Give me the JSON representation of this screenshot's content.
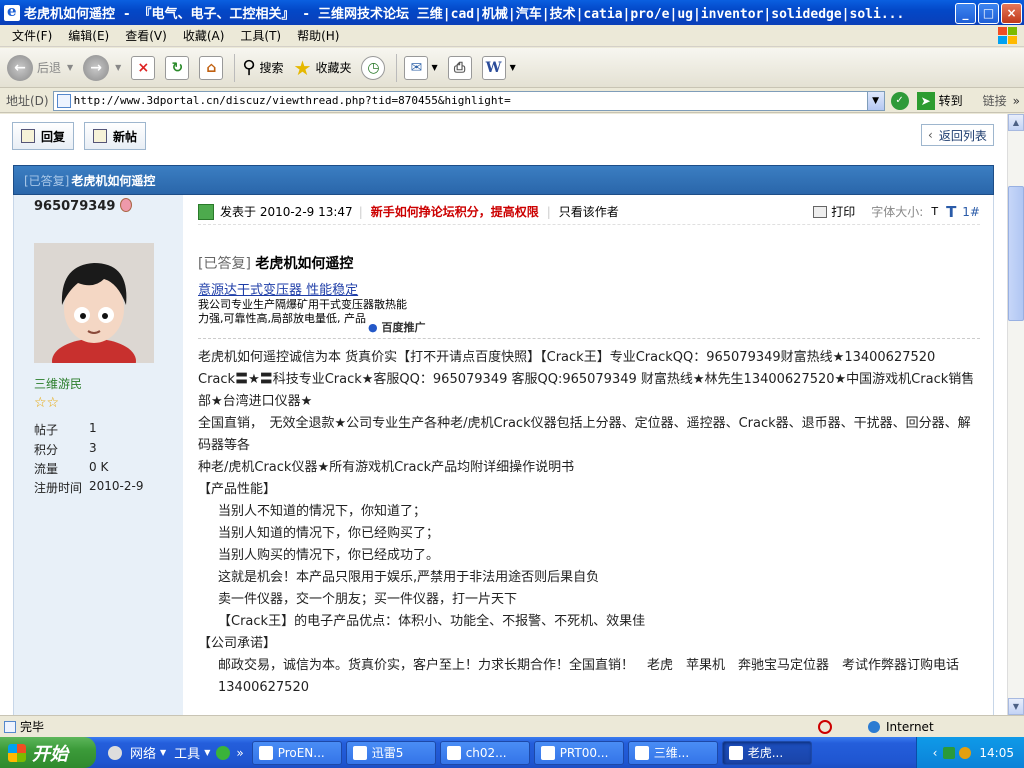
{
  "window": {
    "title": "老虎机如何遥控 - 『电气、电子、工控相关』 - 三维网技术论坛 三维|cad|机械|汽车|技术|catia|pro/e|ug|inventor|solidedge|soli...",
    "controls": [
      "_",
      "□",
      "×"
    ]
  },
  "menu": [
    "文件(F)",
    "编辑(E)",
    "查看(V)",
    "收藏(A)",
    "工具(T)",
    "帮助(H)"
  ],
  "toolbar": {
    "back": "后退",
    "search": "搜索",
    "favorites": "收藏夹"
  },
  "address": {
    "label": "地址(D)",
    "url": "http://www.3dportal.cn/discuz/viewthread.php?tid=870455&highlight=",
    "go": "转到",
    "links": "链接"
  },
  "forum": {
    "reply_button": "回复",
    "new_button": "新帖",
    "back_list": "返回列表",
    "thread_tag": "[已答复]",
    "thread_title": "老虎机如何遥控"
  },
  "user": {
    "name": "965079349",
    "title": "三维游民",
    "stats": [
      {
        "label": "帖子",
        "value": "1"
      },
      {
        "label": "积分",
        "value": "3"
      },
      {
        "label": "流量",
        "value": "0 K"
      },
      {
        "label": "注册时间",
        "value": "2010-2-9"
      }
    ]
  },
  "post": {
    "posted_on": "发表于 2010-2-9 13:47",
    "notice": "新手如何挣论坛积分，提高权限",
    "author_only": "只看该作者",
    "print": "打印",
    "font_size_label": "字体大小:",
    "font_small": "T",
    "font_large": "T",
    "floor": "1#",
    "title_tag": "[已答复]",
    "title": "老虎机如何遥控",
    "ad": {
      "link": "意源达干式变压器 性能稳定",
      "line1": "我公司专业生产隔爆矿用干式变压器散热能",
      "line2": "力强,可靠性高,局部放电量低, 产品",
      "brand": "百度推广"
    },
    "body": [
      {
        "text": "老虎机如何遥控诚信为本 货真价实【打不开请点百度快照】【Crack王】专业CrackQQ：965079349财富热线★13400627520",
        "indent": false
      },
      {
        "text": "Crack〓★〓科技专业Crack★客服QQ：965079349 客服QQ:965079349 财富热线★林先生13400627520★中国游戏机Crack销售部★台湾进口仪器★",
        "indent": false
      },
      {
        "text": "全国直销，　无效全退款★公司专业生产各种老/虎机Crack仪器包括上分器、定位器、遥控器、Crack器、退币器、干扰器、回分器、解码器等各",
        "indent": false
      },
      {
        "text": "种老/虎机Crack仪器★所有游戏机Crack产品均附详细操作说明书",
        "indent": false
      },
      {
        "text": "【产品性能】",
        "indent": false
      },
      {
        "text": "当别人不知道的情况下，你知道了；",
        "indent": true
      },
      {
        "text": "当别人知道的情况下，你已经购买了；",
        "indent": true
      },
      {
        "text": "当别人购买的情况下，你已经成功了。",
        "indent": true
      },
      {
        "text": "这就是机会！本产品只限用于娱乐,严禁用于非法用途否则后果自负",
        "indent": true
      },
      {
        "text": "卖一件仪器，交一个朋友；买一件仪器，打一片天下",
        "indent": true
      },
      {
        "text": "【Crack王】的电子产品优点：体积小、功能全、不报警、不死机、效果佳",
        "indent": true
      },
      {
        "text": "【公司承诺】",
        "indent": false
      },
      {
        "text": "邮政交易，诚信为本。货真价实，客户至上！力求长期合作！全国直销！　老虎　苹果机　奔驰宝马定位器　考试作弊器订购电话13400627520",
        "indent": true
      }
    ]
  },
  "status": {
    "text": "完毕",
    "zone": "Internet"
  },
  "taskbar": {
    "start": "开始",
    "quick": [
      "网络",
      "工具"
    ],
    "tasks": [
      "ProEN...",
      "迅雷5",
      "ch02...",
      "PRT00...",
      "三维...",
      "老虎..."
    ],
    "active_task": 5,
    "clock": "14:05"
  },
  "colors": {
    "thread_header": "#2a66aa",
    "left_panel": "#e8f0f8",
    "notice_red": "#cc0000",
    "user_title_green": "#2a7d2a"
  }
}
